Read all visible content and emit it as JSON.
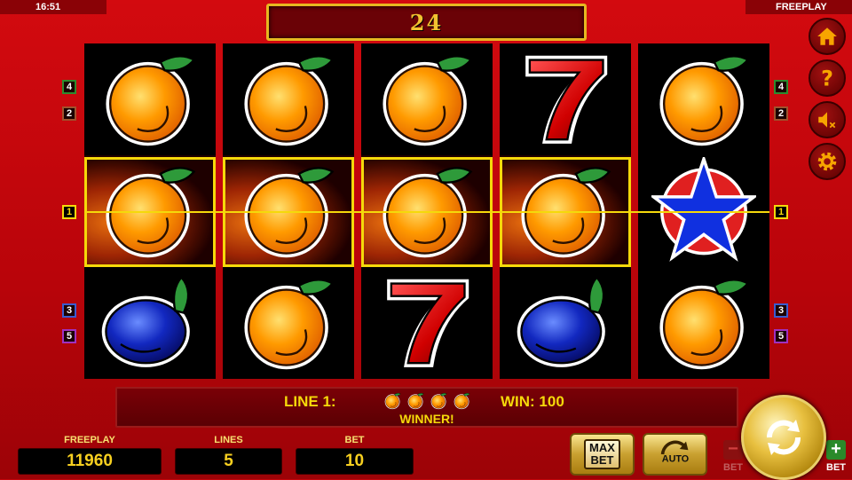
{
  "status": {
    "clock": "16:51",
    "mode": "FREEPLAY"
  },
  "counter": {
    "value": "24"
  },
  "reels": [
    [
      "orange",
      "orange",
      "plum"
    ],
    [
      "orange",
      "orange",
      "orange"
    ],
    [
      "orange",
      "orange",
      "seven"
    ],
    [
      "seven",
      "orange",
      "plum"
    ],
    [
      "orange",
      "star",
      "orange"
    ]
  ],
  "winning_row": 1,
  "winning_reels": 4,
  "paylines_left": [
    "4",
    "2",
    "1",
    "3",
    "5"
  ],
  "paylines_right": [
    "4",
    "2",
    "1",
    "3",
    "5"
  ],
  "payline_colors": {
    "1": "#f5d90a",
    "2": "#a0522d",
    "3": "#3a5cd0",
    "4": "#2e8b2e",
    "5": "#a030c0"
  },
  "side_buttons": [
    "home-icon",
    "help-icon",
    "sound-off-icon",
    "settings-icon"
  ],
  "info": {
    "line_label": "LINE 1:",
    "symbol_count": 4,
    "win_label": "WIN: 100",
    "winner_text": "WINNER!"
  },
  "stats": {
    "freeplay_label": "FREEPLAY",
    "freeplay_value": "11960",
    "lines_label": "LINES",
    "lines_value": "5",
    "bet_label": "BET",
    "bet_value": "10"
  },
  "buttons": {
    "max_bet_line1": "MAX",
    "max_bet_line2": "BET",
    "auto_label": "AUTO",
    "bet_minus_label": "BET",
    "bet_plus_label": "BET",
    "minus_sign": "−",
    "plus_sign": "+"
  },
  "colors": {
    "background": "#c0050a",
    "accent_gold": "#f5d90a",
    "panel": "#6a0206"
  }
}
